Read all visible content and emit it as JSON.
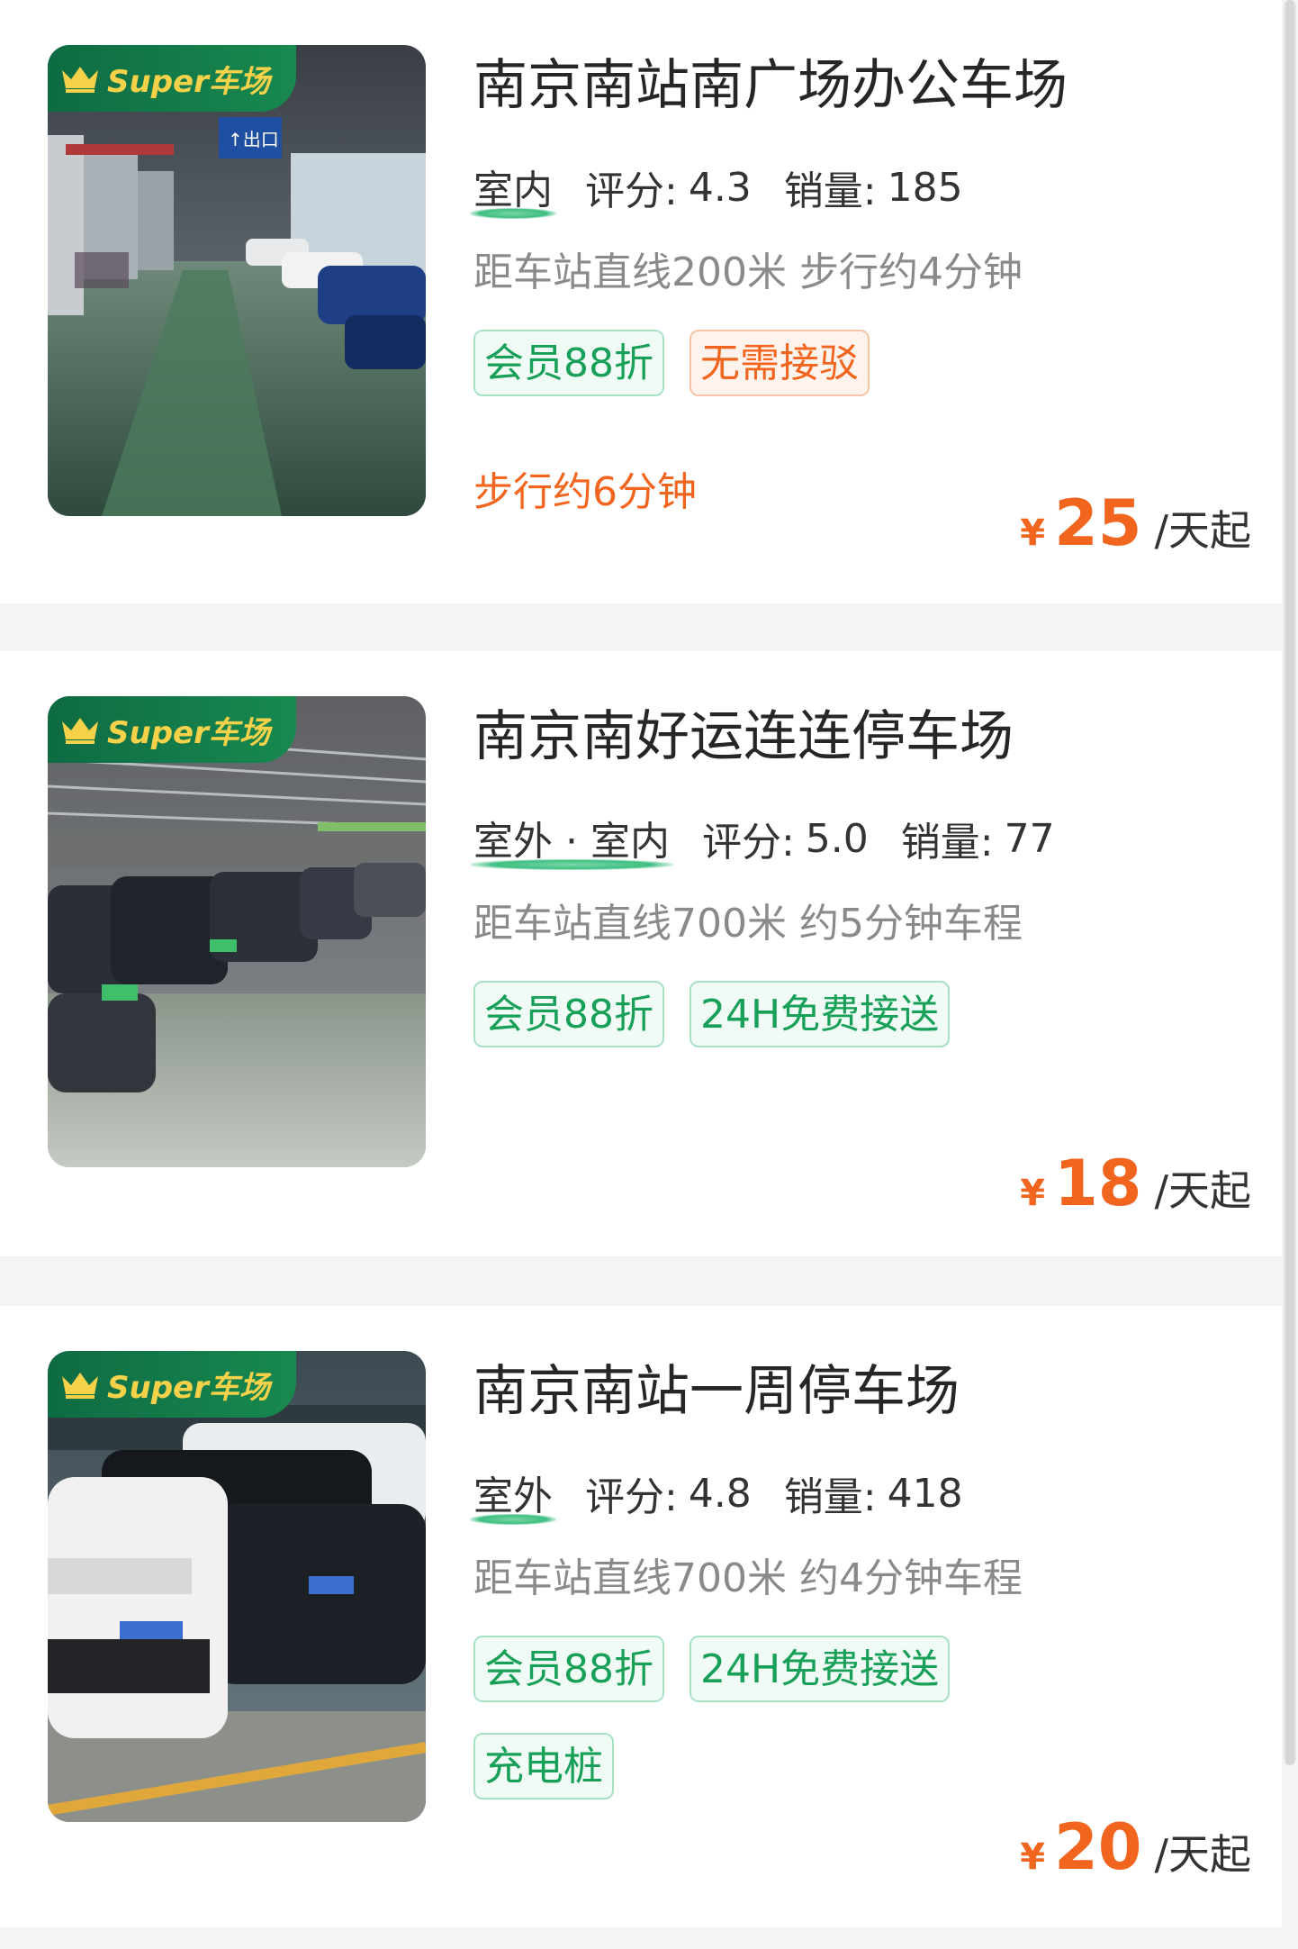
{
  "badge_text": "Super车场",
  "colors": {
    "accent_green": "#18a058",
    "accent_orange": "#f2651e",
    "badge_bg": "#0e6b43",
    "badge_text": "#f6d24a"
  },
  "lots": [
    {
      "name": "南京南站南广场办公车场",
      "type": "室内",
      "rating_label": "评分:",
      "rating": "4.3",
      "sales_label": "销量:",
      "sales": "185",
      "distance": "距车站直线200米 步行约4分钟",
      "tags": [
        "会员88折",
        "无需接驳"
      ],
      "note": "步行约6分钟",
      "currency": "¥",
      "price": "25",
      "unit": "/天起",
      "image": "indoor-parking-photo"
    },
    {
      "name": "南京南好运连连停车场",
      "type": "室外 · 室内",
      "rating_label": "评分:",
      "rating": "5.0",
      "sales_label": "销量:",
      "sales": "77",
      "distance": "距车站直线700米 约5分钟车程",
      "tags": [
        "会员88折",
        "24H免费接送"
      ],
      "note": "",
      "currency": "¥",
      "price": "18",
      "unit": "/天起",
      "image": "covered-parking-photo"
    },
    {
      "name": "南京南站一周停车场",
      "type": "室外",
      "rating_label": "评分:",
      "rating": "4.8",
      "sales_label": "销量:",
      "sales": "418",
      "distance": "距车站直线700米 约4分钟车程",
      "tags": [
        "会员88折",
        "24H免费接送",
        "充电桩"
      ],
      "note": "",
      "currency": "¥",
      "price": "20",
      "unit": "/天起",
      "image": "outdoor-parking-photo"
    }
  ]
}
